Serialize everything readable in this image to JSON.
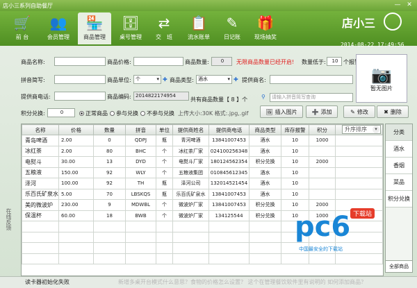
{
  "window": {
    "title": "店小三系列自助餐厅",
    "min": "—",
    "close": "✕"
  },
  "nav": [
    {
      "label": "前 台",
      "icon": "cart-icon",
      "glyph": "🛒"
    },
    {
      "label": "会员管理",
      "icon": "members-icon",
      "glyph": "👥"
    },
    {
      "label": "商品管理",
      "icon": "store-icon",
      "glyph": "🏪"
    },
    {
      "label": "桌号管理",
      "icon": "table-number-icon",
      "glyph": "🗄"
    },
    {
      "label": "交　班",
      "icon": "shift-icon",
      "glyph": "⇄"
    },
    {
      "label": "流水账单",
      "icon": "ledger-icon",
      "glyph": "📋"
    },
    {
      "label": "日记账",
      "icon": "journal-icon",
      "glyph": "✎"
    },
    {
      "label": "现场抽奖",
      "icon": "gift-icon",
      "glyph": "🎁"
    }
  ],
  "brand": "店小三",
  "datetime": "2014-08-22 17:49:56",
  "form": {
    "name_label": "商品名称:",
    "name_value": "",
    "price_label": "商品价格:",
    "price_value": "",
    "qty_label": "商品数量:",
    "qty_value": "0",
    "unlimited_text": "无限商品数量已经开启!",
    "alarm_label": "数量低于:",
    "alarm_value": "10",
    "alarm_unit": "个报警",
    "pinyin_label": "拼音简写:",
    "pinyin_value": "",
    "unit_label": "商品单位:",
    "unit_value": "个",
    "type_label": "商品类型:",
    "type_value": "酒水",
    "supplier_label": "提供商名:",
    "supplier_value": "",
    "phone_label": "提供商电话:",
    "phone_value": "",
    "code_label": "商品编码:",
    "code_value": "2014822174954",
    "total_text": "共有商品数量【 8 】个",
    "search_placeholder": "请输入拼音简写查询",
    "points_label": "积分兑换:",
    "points_value": "0",
    "radio_normal": "正常商品",
    "radio_join": "参与兑换",
    "radio_nojoin": "不参与兑换",
    "upload_hint": "上传大小:30K 格式:.jpg,.gif",
    "photo_text": "暂无图片"
  },
  "buttons": {
    "insert": "插入图片",
    "add": "添加",
    "edit": "修改",
    "delete": "删除"
  },
  "table": {
    "headers": [
      "名称",
      "价格",
      "数量",
      "拼音",
      "单位",
      "提供商姓名",
      "提供商电话",
      "商品类型",
      "库存报警",
      "积分"
    ],
    "rows": [
      [
        "青岛啤酒",
        "2.00",
        "0",
        "QDPJ",
        "瓶",
        "青河啤酒",
        "13841007453",
        "酒水",
        "10",
        "1000"
      ],
      [
        "冰红茶",
        "2.00",
        "80",
        "BHC",
        "个",
        "冰红茶厂家",
        "024100256348",
        "酒水",
        "10",
        ""
      ],
      [
        "电熨斗",
        "30.00",
        "13",
        "DYD",
        "个",
        "电熨斗厂家",
        "180124562354",
        "积分兑换",
        "10",
        "2000"
      ],
      [
        "五粮液",
        "150.00",
        "92",
        "WLY",
        "个",
        "五粮液集团",
        "010845612345",
        "酒水",
        "10",
        ""
      ],
      [
        "泽河",
        "100.00",
        "92",
        "TH",
        "瓶",
        "泽河公司",
        "132014521454",
        "酒水",
        "10",
        ""
      ],
      [
        "乐百氏矿泉水",
        "5.00",
        "70",
        "LBSKQS",
        "瓶",
        "乐百氏矿泉水",
        "13841007453",
        "酒水",
        "10",
        ""
      ],
      [
        "美的微波炉",
        "230.00",
        "9",
        "MDWBL",
        "个",
        "微波炉厂家",
        "13841007453",
        "积分兑换",
        "10",
        "2000"
      ],
      [
        "保温杯",
        "60.00",
        "18",
        "BWB",
        "个",
        "微波炉厂家",
        "134125544",
        "积分兑换",
        "10",
        "1000"
      ]
    ]
  },
  "sort_label": "升序排序",
  "categories": {
    "head": "分类",
    "items": [
      "酒水",
      "香烟",
      "菜品",
      "积分兑换"
    ],
    "all": "全部商品"
  },
  "side_tab": "在线反馈",
  "status": {
    "message": "读卡器初始化失败",
    "scroll": "新增多桌开台模式什么意思？食物的价格怎么设置？    这个在管理餐饮软件里有说明的    如何添加商品？"
  },
  "watermark": {
    "logo": "pc6",
    "tag": "下载站",
    "sub": "中国最安全的下载站"
  }
}
